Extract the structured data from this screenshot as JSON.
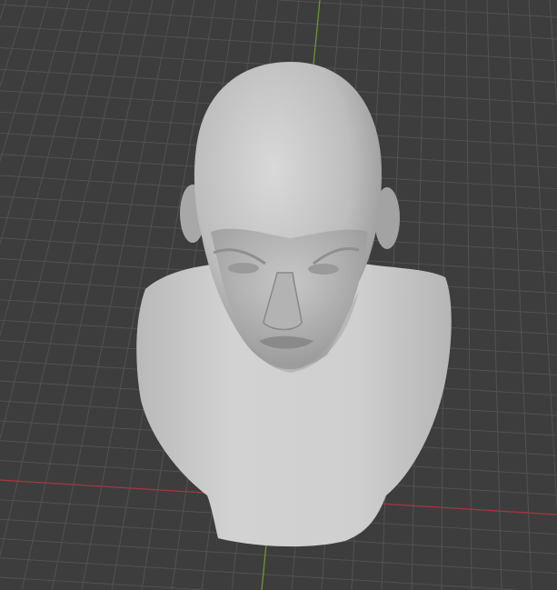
{
  "viewport": {
    "background_color": "#3d3d3d",
    "grid_color": "#525252",
    "x_axis_color": "#a8343d",
    "y_axis_color": "#6b9e2a",
    "mesh_color": "#c4c4c4"
  }
}
